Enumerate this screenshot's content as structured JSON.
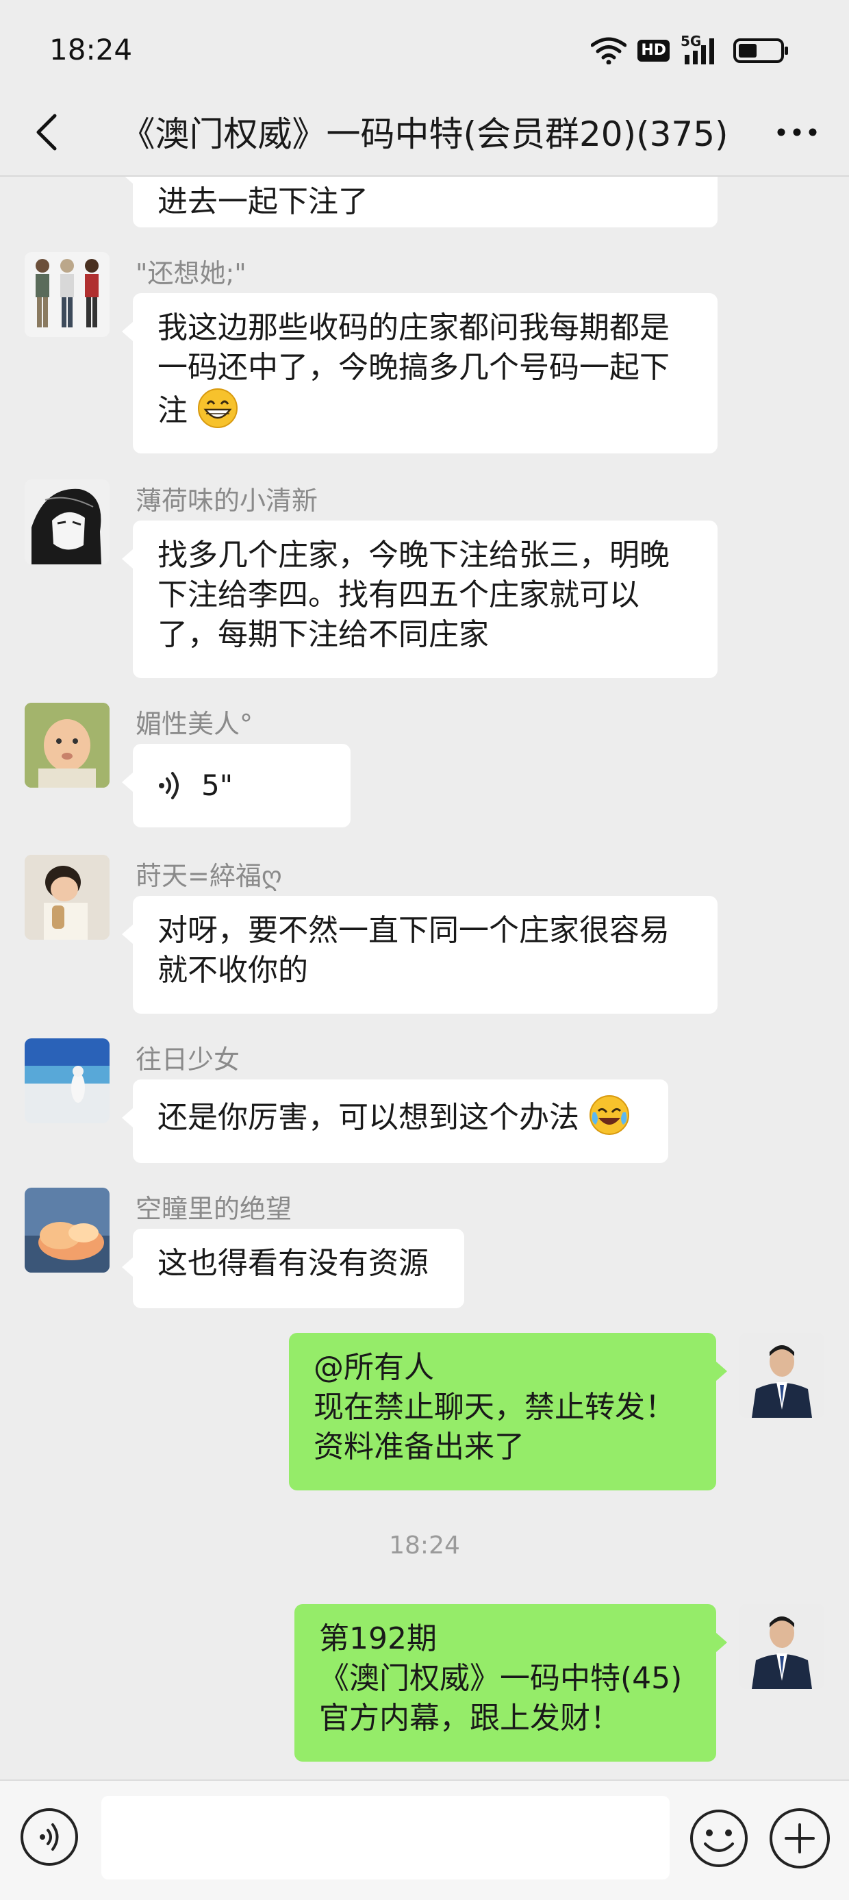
{
  "status_bar": {
    "time": "18:24",
    "icons": [
      "wifi-icon",
      "hd-icon",
      "5g-signal-icon",
      "battery-icon"
    ],
    "hd_label": "HD",
    "network_label": "5G"
  },
  "header": {
    "title": "《澳门权威》一码中特(会员群20)(375)",
    "back_icon": "chevron-left-icon",
    "more_icon": "more-dots-icon"
  },
  "messages": [
    {
      "side": "left",
      "partial": true,
      "text": "进去一起下注了"
    },
    {
      "side": "left",
      "sender": "\"还想她;\"",
      "lines": [
        "我这边那些收码的庄家都问我每期都是",
        "一码还中了，今晚搞多几个号码一起下",
        "注"
      ],
      "emoji": "grin-emoji"
    },
    {
      "side": "left",
      "sender": "薄荷味的小清新",
      "lines": [
        "找多几个庄家，今晚下注给张三，明晚",
        "下注给李四。找有四五个庄家就可以",
        "了，每期下注给不同庄家"
      ]
    },
    {
      "side": "left",
      "sender": "媚性美人°",
      "voice_duration": "5\""
    },
    {
      "side": "left",
      "sender": "莳天=綷福ღ",
      "lines": [
        "对呀，要不然一直下同一个庄家很容易",
        "就不收你的"
      ]
    },
    {
      "side": "left",
      "sender": "往日少女",
      "text": "还是你厉害，可以想到这个办法",
      "emoji": "laugh-cry-emoji"
    },
    {
      "side": "left",
      "sender": "空瞳里的绝望",
      "text": "这也得看有没有资源"
    },
    {
      "side": "right",
      "lines": [
        "@所有人",
        "现在禁止聊天，禁止转发！",
        "资料准备出来了"
      ]
    },
    {
      "side": "right",
      "lines": [
        "第192期",
        "《澳门权威》一码中特(45)",
        "官方内幕，跟上发财！"
      ]
    }
  ],
  "timestamp": "18:24",
  "input_bar": {
    "voice_icon": "voice-input-icon",
    "emoji_icon": "emoji-icon",
    "plus_icon": "plus-icon",
    "text_value": ""
  },
  "colors": {
    "background": "#ededed",
    "bubble_other": "#ffffff",
    "bubble_self": "#95ec69",
    "sender_name": "#8a8a8a"
  }
}
